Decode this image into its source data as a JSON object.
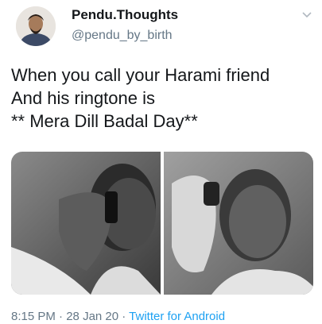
{
  "tweet": {
    "author": {
      "display_name": "Pendu.Thoughts",
      "handle": "@pendu_by_birth",
      "avatar_icon": "profile-avatar"
    },
    "menu_icon": "chevron-down-icon",
    "text_lines": [
      "When you call your Harami friend",
      "And his ringtone is",
      "** Mera Dill Badal Day**"
    ],
    "media": [
      {
        "name": "meme-photo-left",
        "description_icon": "photo"
      },
      {
        "name": "meme-photo-right",
        "description_icon": "photo"
      }
    ],
    "meta": {
      "time": "8:15 PM",
      "separator1": " · ",
      "date": "28 Jan 20",
      "separator2": " · ",
      "source": "Twitter for Android"
    },
    "colors": {
      "link": "#1da1f2",
      "secondary_text": "#657786",
      "primary_text": "#14171a"
    }
  }
}
